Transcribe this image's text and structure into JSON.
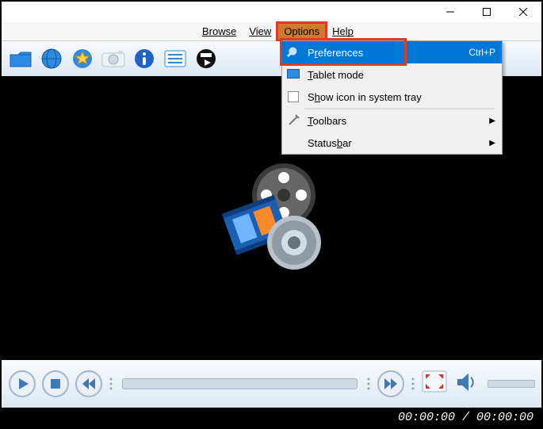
{
  "menubar": {
    "browse": "Browse",
    "view": "View",
    "options": "Options",
    "help": "Help"
  },
  "dropdown": {
    "preferences": {
      "ul": "r",
      "rest": "eferences",
      "shortcut": "Ctrl+P"
    },
    "tablet": {
      "rest": "ablet mode"
    },
    "tray": {
      "rest": "ow icon in system tray"
    },
    "toolbars": {
      "rest": "oolbars"
    },
    "statusbar": {
      "rest": "ar"
    }
  },
  "status": {
    "time": "00:00:00 / 00:00:00"
  }
}
